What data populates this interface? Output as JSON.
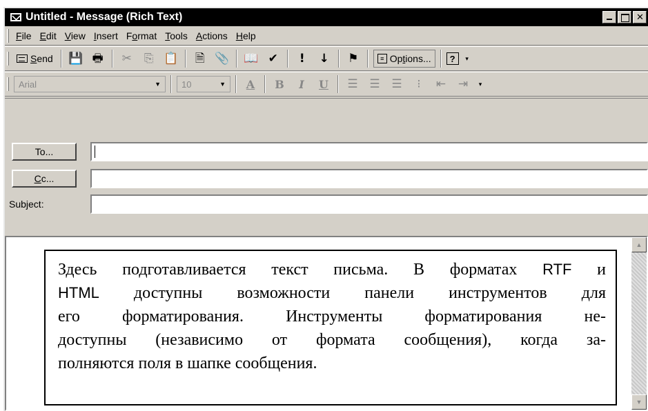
{
  "window": {
    "title": "Untitled - Message (Rich Text)"
  },
  "menubar": {
    "items": [
      {
        "pre": "",
        "key": "F",
        "post": "ile"
      },
      {
        "pre": "",
        "key": "E",
        "post": "dit"
      },
      {
        "pre": "",
        "key": "V",
        "post": "iew"
      },
      {
        "pre": "",
        "key": "I",
        "post": "nsert"
      },
      {
        "pre": "F",
        "key": "o",
        "post": "rmat"
      },
      {
        "pre": "",
        "key": "T",
        "post": "ools"
      },
      {
        "pre": "",
        "key": "A",
        "post": "ctions"
      },
      {
        "pre": "",
        "key": "H",
        "post": "elp"
      }
    ]
  },
  "toolbar": {
    "send_pre": "",
    "send_key": "S",
    "send_post": "end",
    "options_pre": "Op",
    "options_key": "t",
    "options_post": "ions...",
    "icons": {
      "save": "💾",
      "print": "🖶",
      "cut": "✂",
      "copy": "⎘",
      "paste": "📋",
      "check_names": "🗎",
      "attach": "📎",
      "address_book": "📖",
      "check": "✔",
      "importance_high": "!",
      "importance_low": "↓",
      "flag": "⚑",
      "help": "?"
    }
  },
  "format_bar": {
    "font": "Arial",
    "size": "10",
    "bold": "B",
    "italic": "I",
    "underline": "U"
  },
  "header": {
    "to_pre": "To",
    "to_key": "",
    "to_post": "...",
    "cc_pre": "",
    "cc_key": "C",
    "cc_post": "c...",
    "subject_label": "Subject:",
    "to_value": "",
    "cc_value": "",
    "subject_value": ""
  },
  "callout": {
    "lines": [
      {
        "t1": "Здесь подготавливается текст письма. В форматах ",
        "s": "RTF",
        "t2": " и"
      },
      {
        "t1": "",
        "s": "HTML",
        "t2": " доступны возможности панели инструментов для"
      },
      {
        "t1": "его форматирования. Инструменты форматирования не-",
        "s": "",
        "t2": ""
      },
      {
        "t1": "доступны (независимо от формата сообщения), когда за-",
        "s": "",
        "t2": ""
      },
      {
        "t1": "полняются поля в шапке сообщения.",
        "s": "",
        "t2": ""
      }
    ]
  },
  "colors": {
    "window_bg": "#d4d0c8",
    "title_bg": "#000000",
    "field_bg": "#ffffff"
  }
}
